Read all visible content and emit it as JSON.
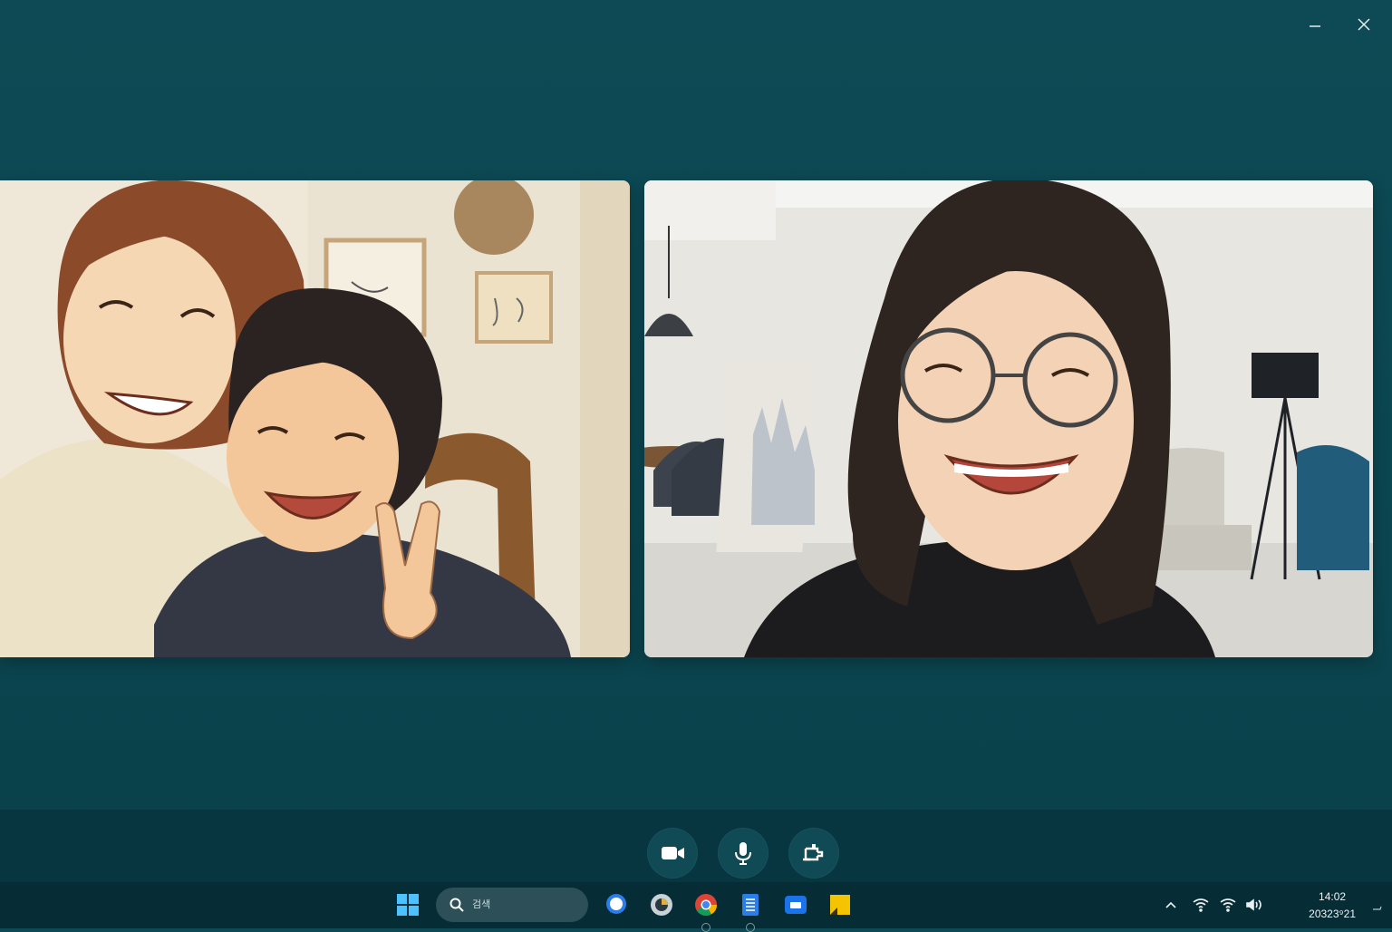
{
  "window": {
    "minimize_icon": "minimize-icon",
    "close_icon": "close-icon"
  },
  "video_tiles": [
    {
      "name": "participant-tile-left",
      "scene": "two-people-smiling"
    },
    {
      "name": "participant-tile-right",
      "scene": "woman-with-glasses-laughing"
    }
  ],
  "controls": [
    {
      "name": "camera-button",
      "icon": "video-camera-icon"
    },
    {
      "name": "microphone-button",
      "icon": "microphone-icon"
    },
    {
      "name": "share-screen-button",
      "icon": "share-screen-icon"
    }
  ],
  "taskbar": {
    "search_placeholder": "검색",
    "apps": [
      "start-icon",
      "chat-icon",
      "app-icon",
      "chrome-icon",
      "notes-icon",
      "mail-icon",
      "files-icon"
    ],
    "clock": {
      "time": "14:02",
      "date": "20323⁹21"
    }
  },
  "colors": {
    "background": "#0d4a55",
    "taskbar": "#062d36",
    "control_bar": "#073540"
  }
}
